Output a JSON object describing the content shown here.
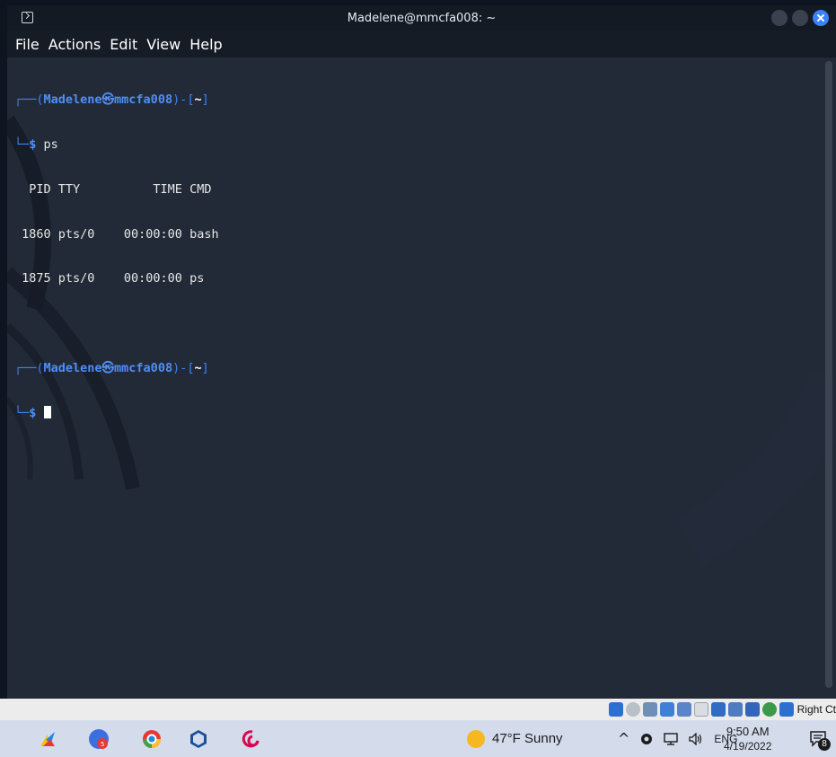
{
  "window": {
    "title": "Madelene@mmcfa008: ~"
  },
  "menu": {
    "items": [
      "File",
      "Actions",
      "Edit",
      "View",
      "Help"
    ]
  },
  "terminal": {
    "prompt1": {
      "frame_top": "┌──(",
      "user": "Madelene",
      "at": "㉿",
      "host": "mmcfa008",
      "mid": ")-[",
      "dir": "~",
      "end": "]",
      "frame_bottom": "└─",
      "symbol": "$",
      "command": "ps"
    },
    "ps_header": "  PID TTY          TIME CMD",
    "ps_rows": [
      " 1860 pts/0    00:00:00 bash",
      " 1875 pts/0    00:00:00 ps"
    ],
    "prompt2": {
      "frame_top": "┌──(",
      "user": "Madelene",
      "at": "㉿",
      "host": "mmcfa008",
      "mid": ")-[",
      "dir": "~",
      "end": "]",
      "frame_bottom": "└─",
      "symbol": "$"
    }
  },
  "vbox_status": {
    "host_key": "Right Ct"
  },
  "taskbar": {
    "weather": "47°F  Sunny",
    "tray_chevron": "^",
    "language": "ENG",
    "time": "9:50 AM",
    "date": "4/19/2022",
    "notification_count": "8"
  },
  "colors": {
    "terminal_bg": "#222a38",
    "prompt_blue": "#3b82f6",
    "taskbar_bg": "#d4dceb"
  }
}
